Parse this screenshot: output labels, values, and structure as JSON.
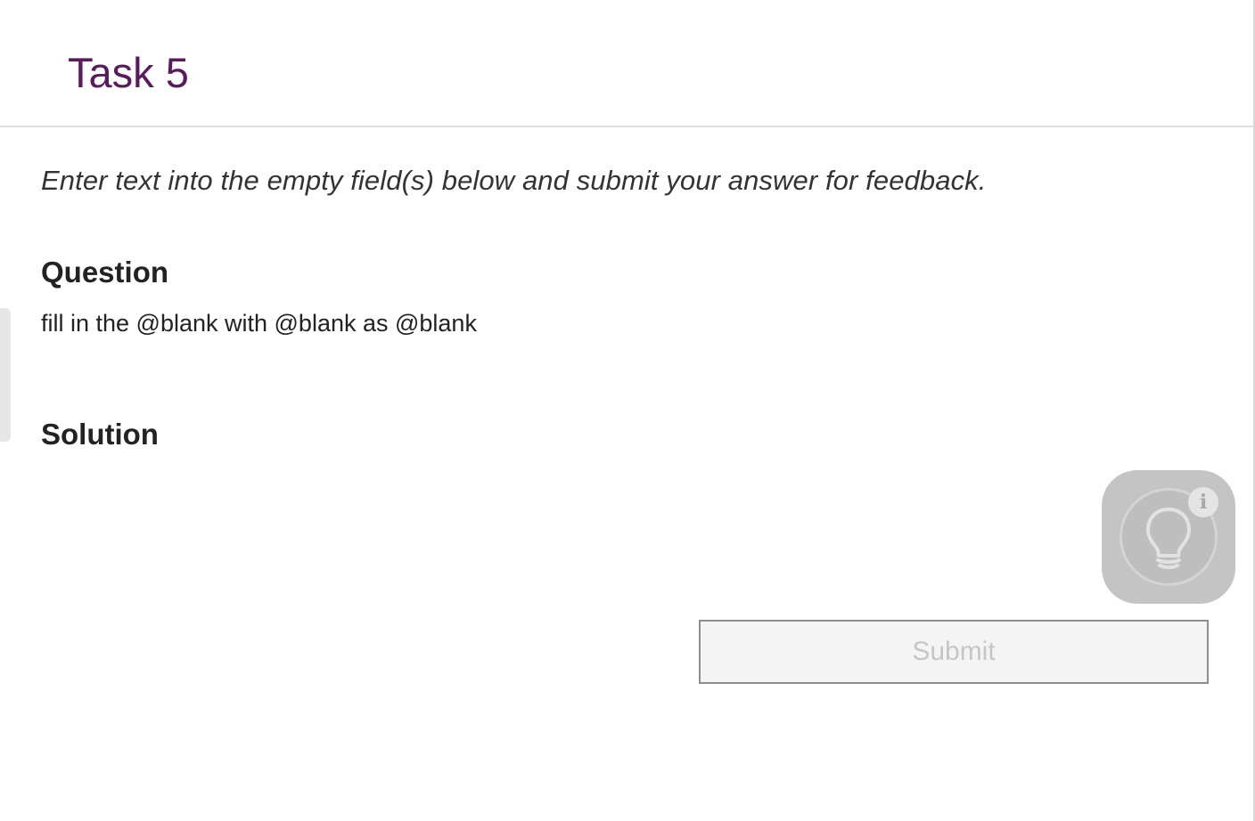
{
  "header": {
    "title": "Task 5"
  },
  "instructions": "Enter text into the empty field(s) below and submit your answer for feedback.",
  "question": {
    "heading": "Question",
    "text": "fill in the @blank with @blank as @blank"
  },
  "solution": {
    "heading": "Solution"
  },
  "hint": {
    "icon": "lightbulb-icon",
    "badge_icon": "info-icon",
    "badge_glyph": "i"
  },
  "submit": {
    "label": "Submit",
    "state": "disabled"
  },
  "colors": {
    "title": "#5b1a5e",
    "text": "#222222",
    "hint_bg": "#c4c4c4",
    "submit_text_disabled": "#c6c6c6"
  }
}
